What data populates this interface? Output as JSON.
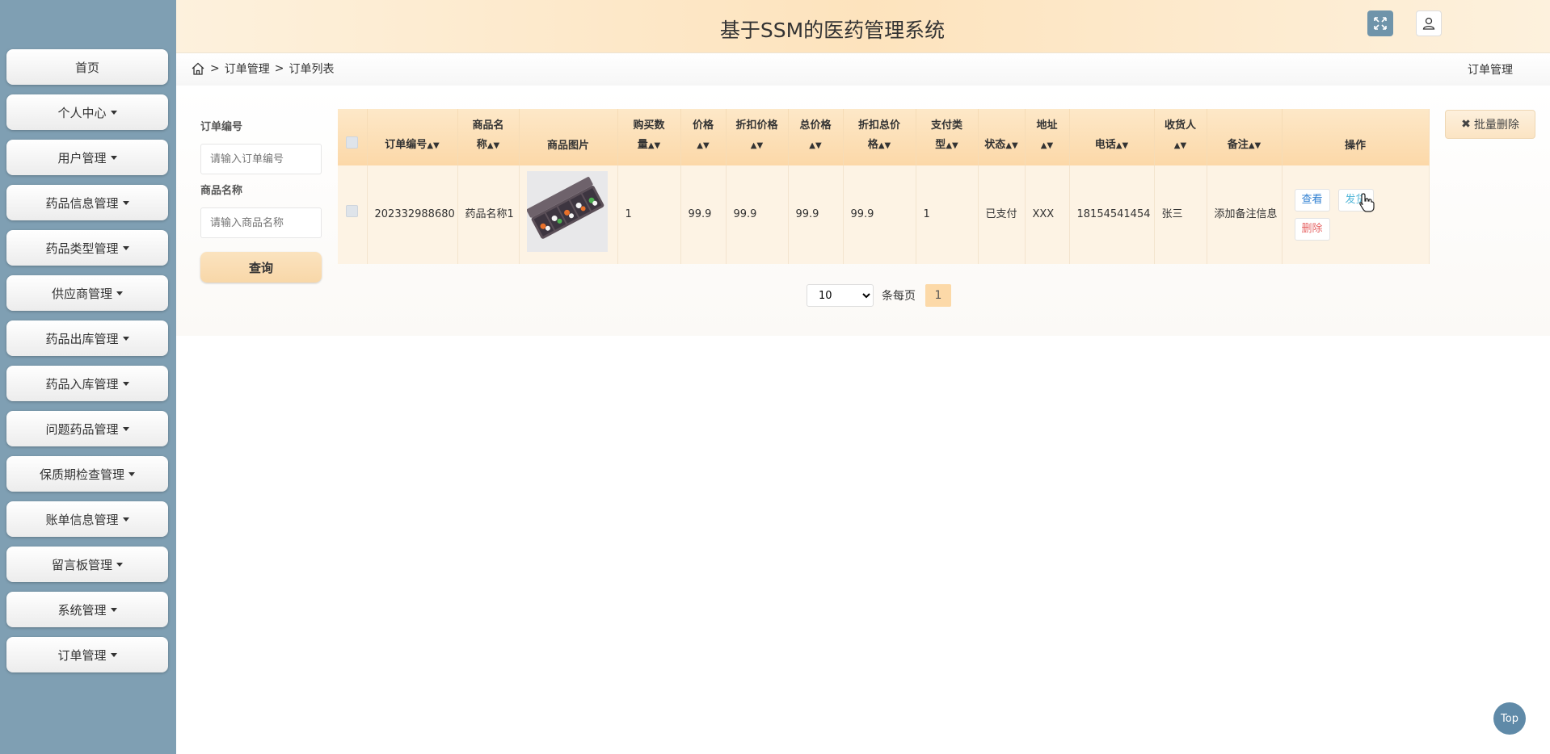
{
  "header": {
    "title": "基于SSM的医药管理系统",
    "expand_icon": "expand-icon",
    "user_icon": "user-icon"
  },
  "sidebar": {
    "items": [
      {
        "label": "首页",
        "caret": false
      },
      {
        "label": "个人中心",
        "caret": true
      },
      {
        "label": "用户管理",
        "caret": true
      },
      {
        "label": "药品信息管理",
        "caret": true
      },
      {
        "label": "药品类型管理",
        "caret": true
      },
      {
        "label": "供应商管理",
        "caret": true
      },
      {
        "label": "药品出库管理",
        "caret": true
      },
      {
        "label": "药品入库管理",
        "caret": true
      },
      {
        "label": "问题药品管理",
        "caret": true
      },
      {
        "label": "保质期检查管理",
        "caret": true
      },
      {
        "label": "账单信息管理",
        "caret": true
      },
      {
        "label": "留言板管理",
        "caret": true
      },
      {
        "label": "系统管理",
        "caret": true
      },
      {
        "label": "订单管理",
        "caret": true
      }
    ]
  },
  "breadcrumb": {
    "items": [
      "订单管理",
      "订单列表"
    ],
    "separator": ">",
    "right_label": "订单管理"
  },
  "search": {
    "order_no_label": "订单编号",
    "order_no_placeholder": "请输入订单编号",
    "product_name_label": "商品名称",
    "product_name_placeholder": "请输入商品名称",
    "query_button": "查询"
  },
  "toolbar": {
    "batch_delete": "批量删除"
  },
  "table": {
    "columns": [
      "订单编号",
      "商品名称",
      "商品图片",
      "购买数量",
      "价格",
      "折扣价格",
      "总价格",
      "折扣总价格",
      "支付类型",
      "状态",
      "地址",
      "电话",
      "收货人",
      "备注",
      "操作"
    ],
    "header_lines": [
      [
        "订单编号"
      ],
      [
        "商品名",
        "称"
      ],
      [
        "商品图片"
      ],
      [
        "购买数",
        "量"
      ],
      [
        "价格",
        ""
      ],
      [
        "折扣价格",
        ""
      ],
      [
        "总价格",
        ""
      ],
      [
        "折扣总价",
        "格"
      ],
      [
        "支付类",
        "型"
      ],
      [
        "状态"
      ],
      [
        "地址",
        ""
      ],
      [
        "电话"
      ],
      [
        "收货人",
        ""
      ],
      [
        "备注"
      ],
      [
        "操作"
      ]
    ],
    "rows": [
      {
        "order_no": "202332988680",
        "product_name": "药品名称1",
        "quantity": "1",
        "price": "99.9",
        "discount_price": "99.9",
        "total_price": "99.9",
        "discount_total": "99.9",
        "pay_type": "1",
        "status": "已支付",
        "address": "XXX",
        "phone": "18154541454",
        "receiver": "张三",
        "remark": "添加备注信息",
        "actions": {
          "view": "查看",
          "ship": "发货",
          "delete": "删除"
        }
      }
    ]
  },
  "pagination": {
    "page_size": "10",
    "per_page_label": "条每页",
    "current_page": "1"
  },
  "top_button": "Top",
  "colors": {
    "sidebar_bg": "#7f9fb3",
    "header_accent": "#fde3bd",
    "table_header": "#fcd8a8",
    "view_blue": "#2f7fd1",
    "ship_cyan": "#52b6d8",
    "delete_red": "#e66464"
  }
}
